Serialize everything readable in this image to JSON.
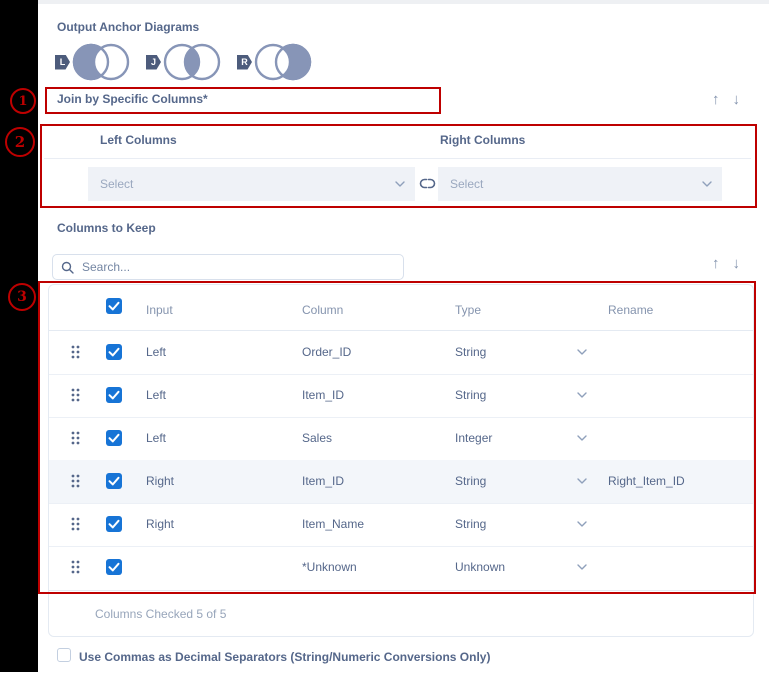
{
  "colors": {
    "accent_blue": "#1774d6",
    "text_slate": "#55678a",
    "venn_fill": "#8795b7",
    "annotation_red": "#be0000"
  },
  "icons": {
    "up_arrow": "↑",
    "down_arrow": "↓"
  },
  "annotations": {
    "markers": [
      {
        "number": "1"
      },
      {
        "number": "2"
      },
      {
        "number": "3"
      }
    ]
  },
  "output_anchor": {
    "label": "Output Anchor Diagrams",
    "anchors": [
      {
        "tag": "L",
        "fill": "left"
      },
      {
        "tag": "J",
        "fill": "intersection"
      },
      {
        "tag": "R",
        "fill": "right"
      }
    ]
  },
  "join_section": {
    "title": "Join by Specific Columns*",
    "left_header": "Left Columns",
    "right_header": "Right Columns",
    "left_select": {
      "value": "Select"
    },
    "right_select": {
      "value": "Select"
    }
  },
  "columns_to_keep": {
    "label": "Columns to Keep",
    "search": {
      "placeholder": "Search..."
    },
    "table": {
      "headers": {
        "input": "Input",
        "column": "Column",
        "type": "Type",
        "rename": "Rename"
      },
      "rows": [
        {
          "checked": true,
          "input": "Left",
          "column": "Order_ID",
          "type": "String",
          "rename": ""
        },
        {
          "checked": true,
          "input": "Left",
          "column": "Item_ID",
          "type": "String",
          "rename": ""
        },
        {
          "checked": true,
          "input": "Left",
          "column": "Sales",
          "type": "Integer",
          "rename": ""
        },
        {
          "checked": true,
          "input": "Right",
          "column": "Item_ID",
          "type": "String",
          "rename": "Right_Item_ID"
        },
        {
          "checked": true,
          "input": "Right",
          "column": "Item_Name",
          "type": "String",
          "rename": ""
        },
        {
          "checked": true,
          "input": "",
          "column": "*Unknown",
          "type": "Unknown",
          "rename": ""
        }
      ],
      "footer": "Columns Checked 5 of 5"
    }
  },
  "decimal_separator": {
    "label": "Use Commas as Decimal Separators (String/Numeric Conversions Only)",
    "checked": false
  }
}
